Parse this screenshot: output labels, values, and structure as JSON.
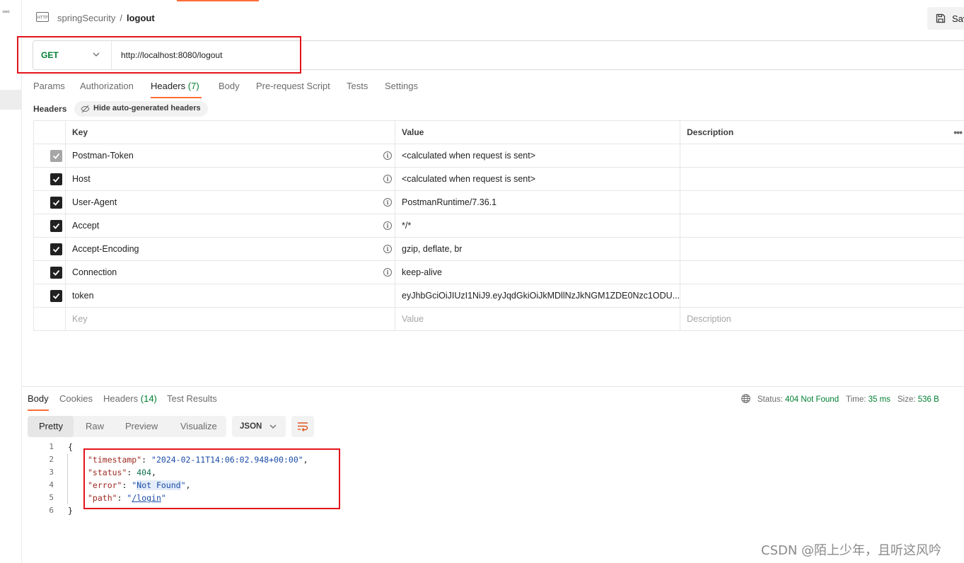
{
  "sidebar": {
    "more_glyph": "°°°"
  },
  "header": {
    "http_icon": "http-icon",
    "breadcrumb": {
      "collection": "springSecurity",
      "separator": "/",
      "request": "logout"
    },
    "save_label": "Sav",
    "save_icon": "save-icon"
  },
  "request": {
    "method": "GET",
    "url": "http://localhost:8080/logout",
    "tabs": [
      {
        "label": "Params"
      },
      {
        "label": "Authorization"
      },
      {
        "label": "Headers",
        "count": "(7)",
        "active": true
      },
      {
        "label": "Body"
      },
      {
        "label": "Pre-request Script"
      },
      {
        "label": "Tests"
      },
      {
        "label": "Settings"
      }
    ]
  },
  "headers_section": {
    "title": "Headers",
    "hide_button": "Hide auto-generated headers",
    "columns": {
      "key": "Key",
      "value": "Value",
      "description": "Description",
      "more": "•••"
    },
    "rows": [
      {
        "key": "Postman-Token",
        "value": "<calculated when request is sent>",
        "checked": true,
        "disabled": true
      },
      {
        "key": "Host",
        "value": "<calculated when request is sent>",
        "checked": true
      },
      {
        "key": "User-Agent",
        "value": "PostmanRuntime/7.36.1",
        "checked": true
      },
      {
        "key": "Accept",
        "value": "*/*",
        "checked": true
      },
      {
        "key": "Accept-Encoding",
        "value": "gzip, deflate, br",
        "checked": true
      },
      {
        "key": "Connection",
        "value": "keep-alive",
        "checked": true
      },
      {
        "key": "token",
        "value": "eyJhbGciOiJIUzI1NiJ9.eyJqdGkiOiJkMDllNzJkNGM1ZDE0Nzc1ODU...",
        "checked": true
      }
    ],
    "placeholder": {
      "key": "Key",
      "value": "Value",
      "description": "Description"
    }
  },
  "response": {
    "tabs": [
      {
        "label": "Body",
        "active": true
      },
      {
        "label": "Cookies"
      },
      {
        "label": "Headers",
        "count": "(14)"
      },
      {
        "label": "Test Results"
      }
    ],
    "status_label": "Status:",
    "status_value": "404 Not Found",
    "time_label": "Time:",
    "time_value": "35 ms",
    "size_label": "Size:",
    "size_value": "536 B",
    "view_modes": [
      "Pretty",
      "Raw",
      "Preview",
      "Visualize"
    ],
    "active_view": "Pretty",
    "format": "JSON",
    "body": {
      "line_numbers": [
        "1",
        "2",
        "3",
        "4",
        "5",
        "6"
      ],
      "open_brace": "{",
      "close_brace": "}",
      "timestamp_key": "\"timestamp\"",
      "timestamp_value": "\"2024-02-11T14:06:02.948+00:00\"",
      "status_key": "\"status\"",
      "status_value": "404",
      "error_key": "\"error\"",
      "error_value": "Not Found",
      "path_key": "\"path\"",
      "path_value": "/login"
    }
  },
  "watermark": "CSDN @陌上少年，且听这风吟",
  "colors": {
    "accent": "#ff6c37",
    "success": "#007f31",
    "highlight_box": "#e3141b"
  }
}
